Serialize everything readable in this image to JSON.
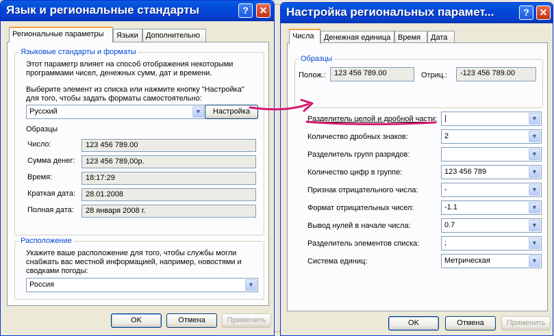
{
  "left_dialog": {
    "title": "Язык и региональные стандарты",
    "tabs": [
      "Региональные параметры",
      "Языки",
      "Дополнительно"
    ],
    "group_formats": {
      "label": "Языковые стандарты и форматы",
      "description": "Этот параметр влияет на способ отображения некоторыми программами чисел, денежных сумм, дат и времени.",
      "description_line1": "Этот параметр влияет на способ отображения некоторыми",
      "description_line2": "программами чисел, денежных сумм, дат и времени.",
      "choose_line1": "Выберите элемент из списка или нажмите кнопку \"Настройка\"",
      "choose_line2": "для того, чтобы задать форматы самостоятельно:",
      "locale_value": "Русский",
      "customize_button": "Настройка",
      "samples_label": "Образцы",
      "samples": [
        {
          "label": "Число:",
          "value": "123 456 789.00"
        },
        {
          "label": "Сумма денег:",
          "value": "123 456 789,00р."
        },
        {
          "label": "Время:",
          "value": "18:17:29"
        },
        {
          "label": "Краткая дата:",
          "value": "28.01.2008"
        },
        {
          "label": "Полная дата:",
          "value": "28 января 2008 г."
        }
      ]
    },
    "group_location": {
      "label": "Расположение",
      "line1": "Укажите ваше расположение для того, чтобы службы могли",
      "line2": "снабжать вас местной информацией, например, новостями и",
      "line3": "сводками погоды:",
      "value": "Россия"
    },
    "buttons": {
      "ok": "OK",
      "cancel": "Отмена",
      "apply": "Применить"
    }
  },
  "right_dialog": {
    "title": "Настройка региональных парамет...",
    "tabs": [
      "Числа",
      "Денежная единица",
      "Время",
      "Дата"
    ],
    "samples_label": "Образцы",
    "positive_label": "Полож.:",
    "positive_value": "123 456 789.00",
    "negative_label": "Отриц.:",
    "negative_value": "-123 456 789.00",
    "settings": [
      {
        "label": "Разделитель целой и дробной части:",
        "value": "|"
      },
      {
        "label": "Количество дробных знаков:",
        "value": "2"
      },
      {
        "label": "Разделитель групп разрядов:",
        "value": ""
      },
      {
        "label": "Количество цифр в группе:",
        "value": "123 456 789"
      },
      {
        "label": "Признак отрицательного числа:",
        "value": "-"
      },
      {
        "label": "Формат отрицательных чисел:",
        "value": "-1.1"
      },
      {
        "label": "Вывод нулей в начале числа:",
        "value": "0.7"
      },
      {
        "label": "Разделитель элементов списка:",
        "value": ";"
      },
      {
        "label": "Система единиц:",
        "value": "Метрическая"
      }
    ],
    "buttons": {
      "ok": "OK",
      "cancel": "Отмена",
      "apply": "Применить"
    }
  },
  "colors": {
    "annotation": "#d6166f",
    "titlebar": "#0a4fd8"
  }
}
